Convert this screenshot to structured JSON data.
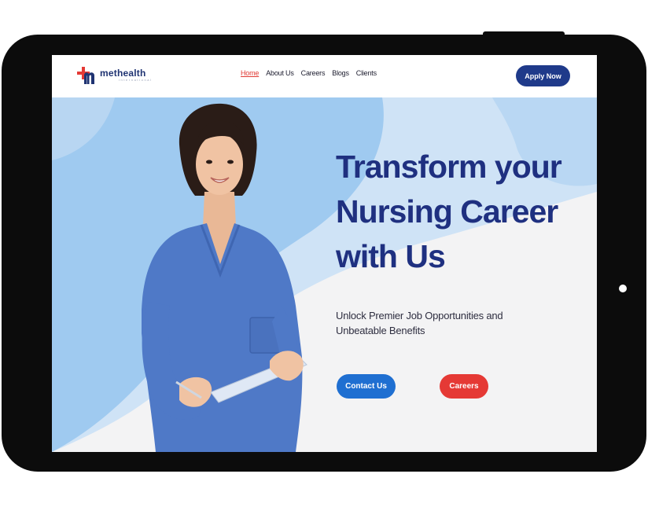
{
  "brand": {
    "name": "methealth",
    "subtitle": "international",
    "colors": {
      "navy": "#1f3a8a",
      "red": "#e53935",
      "blue": "#1f6fd1",
      "heading": "#1f3080"
    }
  },
  "nav": {
    "items": [
      {
        "label": "Home",
        "active": true
      },
      {
        "label": "About Us",
        "active": false
      },
      {
        "label": "Careers",
        "active": false
      },
      {
        "label": "Blogs",
        "active": false
      },
      {
        "label": "Clients",
        "active": false
      }
    ]
  },
  "header": {
    "apply_label": "Apply Now"
  },
  "hero": {
    "title_lines": [
      "Transform your",
      "Nursing Career",
      "with Us"
    ],
    "subtitle_lines": [
      "Unlock Premier Job Opportunities and",
      "Unbeatable Benefits"
    ],
    "contact_label": "Contact Us",
    "careers_label": "Careers",
    "image": "nurse-in-blue-scrubs-holding-clipboard"
  }
}
